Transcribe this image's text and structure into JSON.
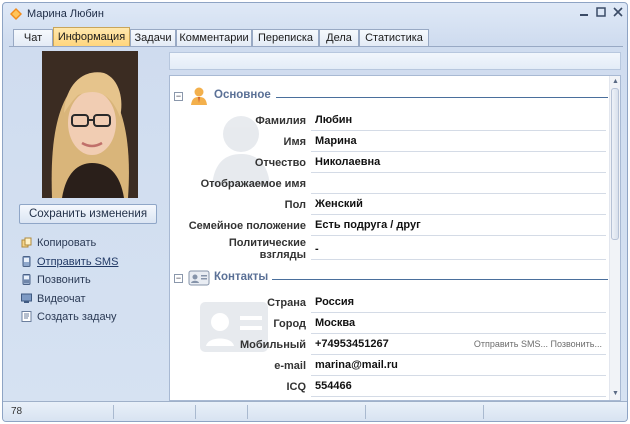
{
  "window": {
    "title": "Марина Любин",
    "app_icon": "chat-bubble-icon"
  },
  "tabs": [
    {
      "label": "Чат",
      "active": false
    },
    {
      "label": "Информация",
      "active": true
    },
    {
      "label": "Задачи",
      "active": false
    },
    {
      "label": "Комментарии",
      "active": false
    },
    {
      "label": "Переписка",
      "active": false
    },
    {
      "label": "Дела",
      "active": false
    },
    {
      "label": "Статистика",
      "active": false
    }
  ],
  "left": {
    "save_label": "Сохранить изменения",
    "actions": [
      {
        "label": "Копировать",
        "icon": "copy-icon",
        "link": false
      },
      {
        "label": "Отправить SMS",
        "icon": "sms-icon",
        "link": true
      },
      {
        "label": "Позвонить",
        "icon": "phone-icon",
        "link": false
      },
      {
        "label": "Видеочат",
        "icon": "video-icon",
        "link": false
      },
      {
        "label": "Создать задачу",
        "icon": "task-icon",
        "link": false
      }
    ]
  },
  "sections": {
    "basic": {
      "title": "Основное",
      "icon": "person-icon",
      "fields": [
        {
          "label": "Фамилия",
          "value": "Любин"
        },
        {
          "label": "Имя",
          "value": "Марина"
        },
        {
          "label": "Отчество",
          "value": "Николаевна"
        },
        {
          "label": "Отображаемое имя",
          "value": ""
        },
        {
          "label": "Пол",
          "value": "Женский"
        },
        {
          "label": "Семейное положение",
          "value": "Есть подруга / друг"
        },
        {
          "label": "Политические взгляды",
          "label_line1": "Политические",
          "label_line2": "взгляды",
          "value": "-"
        }
      ]
    },
    "contacts": {
      "title": "Контакты",
      "icon": "contact-card-icon",
      "fields": [
        {
          "label": "Страна",
          "value": "Россия"
        },
        {
          "label": "Город",
          "value": "Москва"
        },
        {
          "label": "Мобильный",
          "value": "+74953451267",
          "extra": "Отправить SMS... Позвонить..."
        },
        {
          "label": "e-mail",
          "value": "marina@mail.ru"
        },
        {
          "label": "ICQ",
          "value": "554466"
        }
      ]
    }
  },
  "status": {
    "text": "78"
  },
  "colors": {
    "active_tab": "#ffd57a",
    "section_title": "#5a7096",
    "rule": "#4a6f9c"
  }
}
